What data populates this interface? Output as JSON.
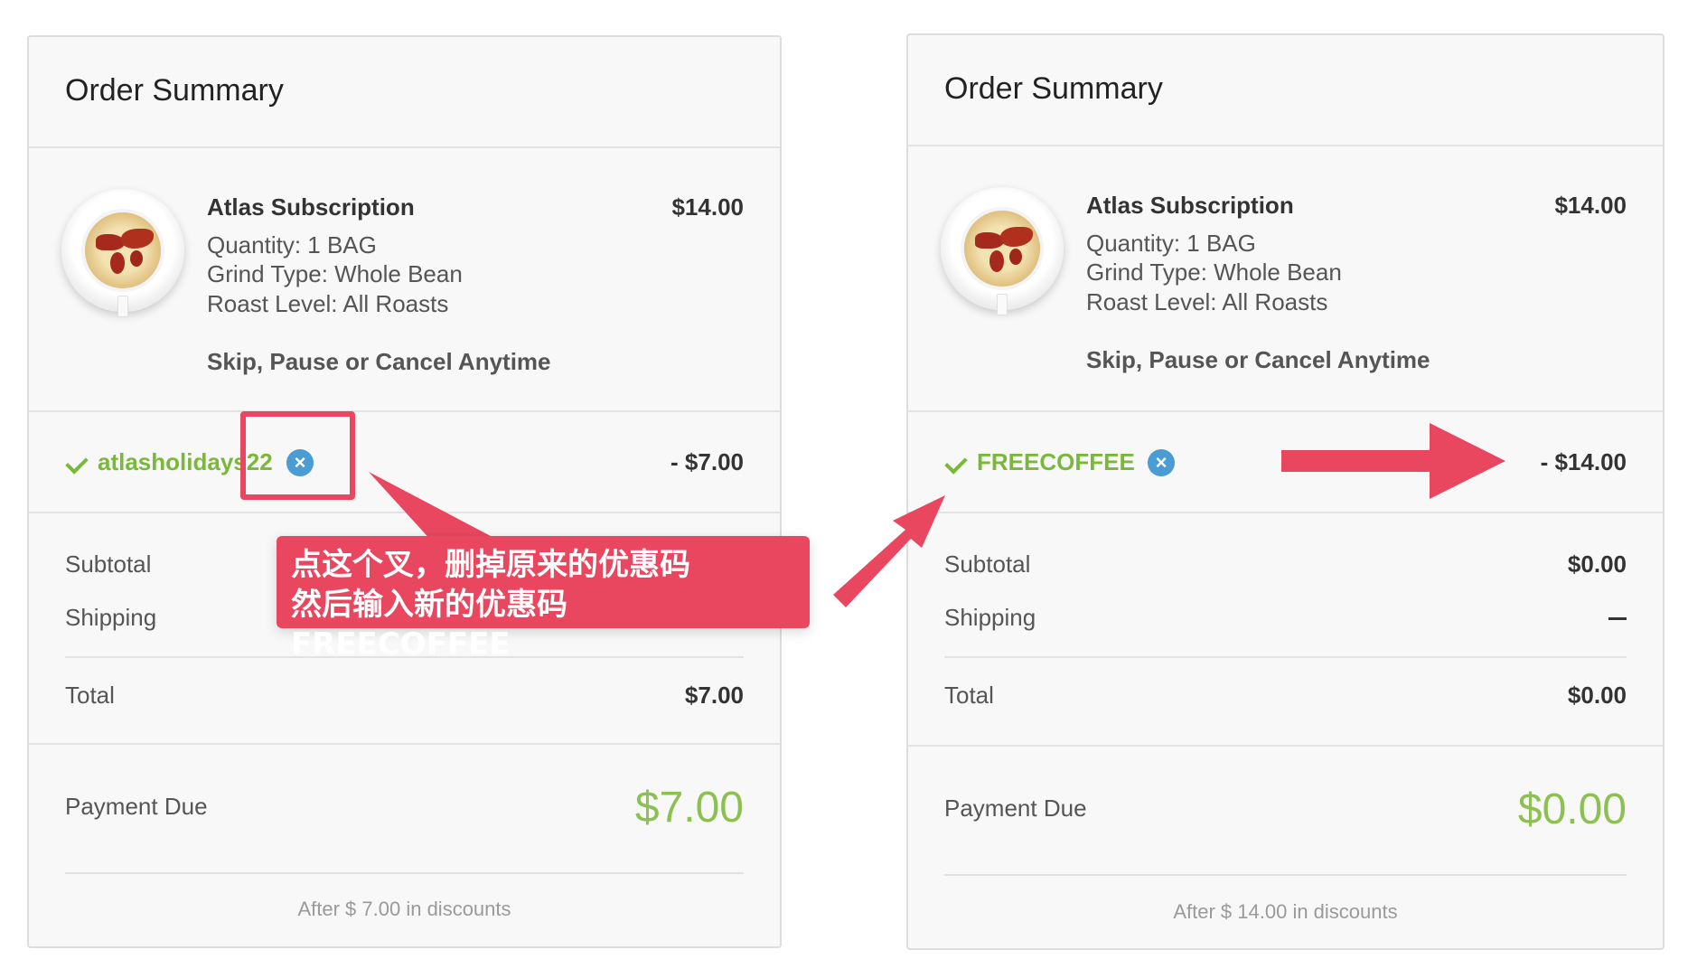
{
  "left": {
    "title": "Order Summary",
    "product": {
      "name": "Atlas Subscription",
      "price": "$14.00",
      "quantity": "Quantity: 1 BAG",
      "grind": "Grind Type: Whole Bean",
      "roast": "Roast Level: All Roasts",
      "note": "Skip, Pause or Cancel Anytime"
    },
    "coupon": {
      "code": "atlasholidays22",
      "remove_icon": "x-circle-icon",
      "discount": "- $7.00"
    },
    "subtotal_label": "Subtotal",
    "shipping_label": "Shipping",
    "total_label": "Total",
    "total_value": "$7.00",
    "payment_due_label": "Payment Due",
    "payment_due_value": "$7.00",
    "footer": "After $ 7.00 in discounts"
  },
  "right": {
    "title": "Order Summary",
    "product": {
      "name": "Atlas Subscription",
      "price": "$14.00",
      "quantity": "Quantity: 1 BAG",
      "grind": "Grind Type: Whole Bean",
      "roast": "Roast Level: All Roasts",
      "note": "Skip, Pause or Cancel Anytime"
    },
    "coupon": {
      "code": "FREECOFFEE",
      "remove_icon": "x-circle-icon",
      "discount": "- $14.00"
    },
    "subtotal_label": "Subtotal",
    "subtotal_value": "$0.00",
    "shipping_label": "Shipping",
    "shipping_value": "—",
    "total_label": "Total",
    "total_value": "$0.00",
    "payment_due_label": "Payment Due",
    "payment_due_value": "$0.00",
    "footer": "After $ 14.00 in discounts"
  },
  "annotation": {
    "line1": "点这个叉，删掉原来的优惠码",
    "line2": "然后输入新的优惠码 FREECOFFEE",
    "color": "#e8475f"
  },
  "colors": {
    "accent_green": "#8cc152",
    "coupon_green": "#7ab83a",
    "remove_blue": "#4a9cd2",
    "panel_bg": "#f8f8f8"
  }
}
